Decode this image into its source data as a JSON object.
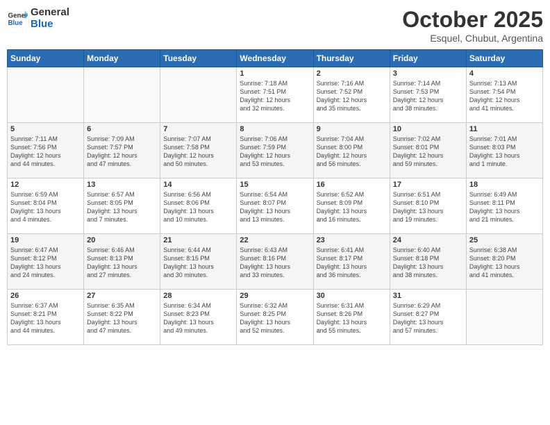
{
  "logo": {
    "line1": "General",
    "line2": "Blue"
  },
  "title": "October 2025",
  "subtitle": "Esquel, Chubut, Argentina",
  "days_of_week": [
    "Sunday",
    "Monday",
    "Tuesday",
    "Wednesday",
    "Thursday",
    "Friday",
    "Saturday"
  ],
  "weeks": [
    [
      {
        "day": "",
        "info": ""
      },
      {
        "day": "",
        "info": ""
      },
      {
        "day": "",
        "info": ""
      },
      {
        "day": "1",
        "info": "Sunrise: 7:18 AM\nSunset: 7:51 PM\nDaylight: 12 hours\nand 32 minutes."
      },
      {
        "day": "2",
        "info": "Sunrise: 7:16 AM\nSunset: 7:52 PM\nDaylight: 12 hours\nand 35 minutes."
      },
      {
        "day": "3",
        "info": "Sunrise: 7:14 AM\nSunset: 7:53 PM\nDaylight: 12 hours\nand 38 minutes."
      },
      {
        "day": "4",
        "info": "Sunrise: 7:13 AM\nSunset: 7:54 PM\nDaylight: 12 hours\nand 41 minutes."
      }
    ],
    [
      {
        "day": "5",
        "info": "Sunrise: 7:11 AM\nSunset: 7:56 PM\nDaylight: 12 hours\nand 44 minutes."
      },
      {
        "day": "6",
        "info": "Sunrise: 7:09 AM\nSunset: 7:57 PM\nDaylight: 12 hours\nand 47 minutes."
      },
      {
        "day": "7",
        "info": "Sunrise: 7:07 AM\nSunset: 7:58 PM\nDaylight: 12 hours\nand 50 minutes."
      },
      {
        "day": "8",
        "info": "Sunrise: 7:06 AM\nSunset: 7:59 PM\nDaylight: 12 hours\nand 53 minutes."
      },
      {
        "day": "9",
        "info": "Sunrise: 7:04 AM\nSunset: 8:00 PM\nDaylight: 12 hours\nand 56 minutes."
      },
      {
        "day": "10",
        "info": "Sunrise: 7:02 AM\nSunset: 8:01 PM\nDaylight: 12 hours\nand 59 minutes."
      },
      {
        "day": "11",
        "info": "Sunrise: 7:01 AM\nSunset: 8:03 PM\nDaylight: 13 hours\nand 1 minute."
      }
    ],
    [
      {
        "day": "12",
        "info": "Sunrise: 6:59 AM\nSunset: 8:04 PM\nDaylight: 13 hours\nand 4 minutes."
      },
      {
        "day": "13",
        "info": "Sunrise: 6:57 AM\nSunset: 8:05 PM\nDaylight: 13 hours\nand 7 minutes."
      },
      {
        "day": "14",
        "info": "Sunrise: 6:56 AM\nSunset: 8:06 PM\nDaylight: 13 hours\nand 10 minutes."
      },
      {
        "day": "15",
        "info": "Sunrise: 6:54 AM\nSunset: 8:07 PM\nDaylight: 13 hours\nand 13 minutes."
      },
      {
        "day": "16",
        "info": "Sunrise: 6:52 AM\nSunset: 8:09 PM\nDaylight: 13 hours\nand 16 minutes."
      },
      {
        "day": "17",
        "info": "Sunrise: 6:51 AM\nSunset: 8:10 PM\nDaylight: 13 hours\nand 19 minutes."
      },
      {
        "day": "18",
        "info": "Sunrise: 6:49 AM\nSunset: 8:11 PM\nDaylight: 13 hours\nand 21 minutes."
      }
    ],
    [
      {
        "day": "19",
        "info": "Sunrise: 6:47 AM\nSunset: 8:12 PM\nDaylight: 13 hours\nand 24 minutes."
      },
      {
        "day": "20",
        "info": "Sunrise: 6:46 AM\nSunset: 8:13 PM\nDaylight: 13 hours\nand 27 minutes."
      },
      {
        "day": "21",
        "info": "Sunrise: 6:44 AM\nSunset: 8:15 PM\nDaylight: 13 hours\nand 30 minutes."
      },
      {
        "day": "22",
        "info": "Sunrise: 6:43 AM\nSunset: 8:16 PM\nDaylight: 13 hours\nand 33 minutes."
      },
      {
        "day": "23",
        "info": "Sunrise: 6:41 AM\nSunset: 8:17 PM\nDaylight: 13 hours\nand 36 minutes."
      },
      {
        "day": "24",
        "info": "Sunrise: 6:40 AM\nSunset: 8:18 PM\nDaylight: 13 hours\nand 38 minutes."
      },
      {
        "day": "25",
        "info": "Sunrise: 6:38 AM\nSunset: 8:20 PM\nDaylight: 13 hours\nand 41 minutes."
      }
    ],
    [
      {
        "day": "26",
        "info": "Sunrise: 6:37 AM\nSunset: 8:21 PM\nDaylight: 13 hours\nand 44 minutes."
      },
      {
        "day": "27",
        "info": "Sunrise: 6:35 AM\nSunset: 8:22 PM\nDaylight: 13 hours\nand 47 minutes."
      },
      {
        "day": "28",
        "info": "Sunrise: 6:34 AM\nSunset: 8:23 PM\nDaylight: 13 hours\nand 49 minutes."
      },
      {
        "day": "29",
        "info": "Sunrise: 6:32 AM\nSunset: 8:25 PM\nDaylight: 13 hours\nand 52 minutes."
      },
      {
        "day": "30",
        "info": "Sunrise: 6:31 AM\nSunset: 8:26 PM\nDaylight: 13 hours\nand 55 minutes."
      },
      {
        "day": "31",
        "info": "Sunrise: 6:29 AM\nSunset: 8:27 PM\nDaylight: 13 hours\nand 57 minutes."
      },
      {
        "day": "",
        "info": ""
      }
    ]
  ]
}
